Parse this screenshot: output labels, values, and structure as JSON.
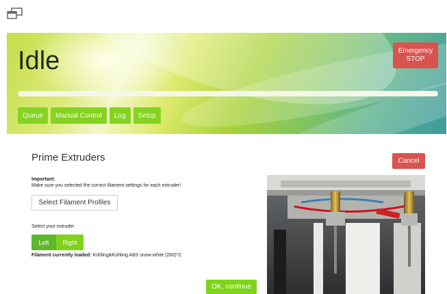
{
  "header": {
    "status": "Idle",
    "emergency_stop_label": "Emergency\nSTOP",
    "progress_percent": 0,
    "nav": [
      "Queue",
      "Manual Control",
      "Log",
      "Setup"
    ]
  },
  "panel": {
    "title": "Prime Extruders",
    "cancel_label": "Cancel",
    "important_title": "Important:",
    "important_text": "Make sure you selected the correct filament settings for each extruder!",
    "select_profiles_label": "Select Filament Profiles",
    "select_extruder_label": "Select your extruder",
    "extruders": [
      "Left",
      "Right"
    ],
    "selected_extruder": "Left",
    "filament_label": "Filament currently loaded:",
    "filament_value": "Kühling&Kühling ABS snow-white (260)°C",
    "ok_label": "OK, continue"
  },
  "colors": {
    "danger": "#d9534f",
    "accent_green": "#7fd319",
    "active_green": "#5cb82a"
  },
  "icons": [
    "window-restore-icon"
  ]
}
